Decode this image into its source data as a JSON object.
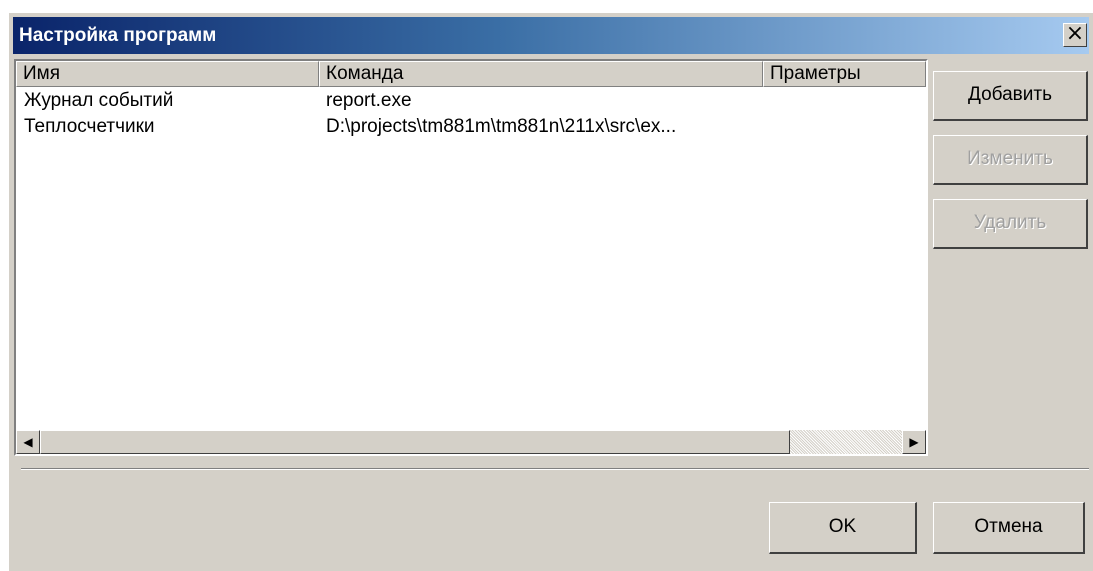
{
  "window": {
    "title": "Настройка программ",
    "close_symbol": "×"
  },
  "list": {
    "columns": [
      "Имя",
      "Команда",
      "Праметры"
    ],
    "rows": [
      {
        "name": "Журнал событий",
        "command": "report.exe",
        "params": ""
      },
      {
        "name": "Теплосчетчики",
        "command": "D:\\projects\\tm881m\\tm881n\\211x\\src\\ex...",
        "params": ""
      }
    ],
    "scroll_left_icon": "◀",
    "scroll_right_icon": "▶"
  },
  "buttons": {
    "add": "Добавить",
    "edit": "Изменить",
    "delete": "Удалить",
    "ok": "OK",
    "cancel": "Отмена"
  },
  "colors": {
    "title_gradient_start": "#0a246a",
    "title_gradient_end": "#a6caf0",
    "face": "#d4d0c8",
    "disabled_text": "#a0a0a0"
  }
}
